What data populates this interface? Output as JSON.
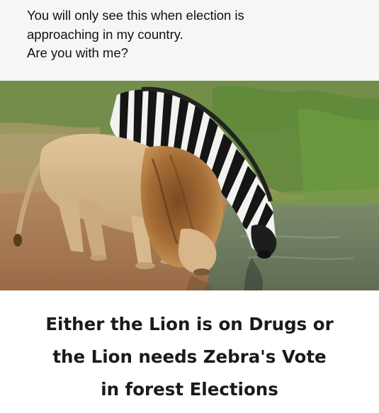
{
  "top_caption": {
    "line1": "You will only see this when election is",
    "line2": "approaching in my country.",
    "line3": "Are you with me?"
  },
  "photo": {
    "subjects": [
      "lion",
      "zebra"
    ],
    "scene": "lion and zebra drinking side by side at a waterhole"
  },
  "bottom_caption": {
    "line1": "Either the Lion is on Drugs or",
    "line2": "the Lion needs Zebra's Vote",
    "line3": "in forest Elections"
  }
}
